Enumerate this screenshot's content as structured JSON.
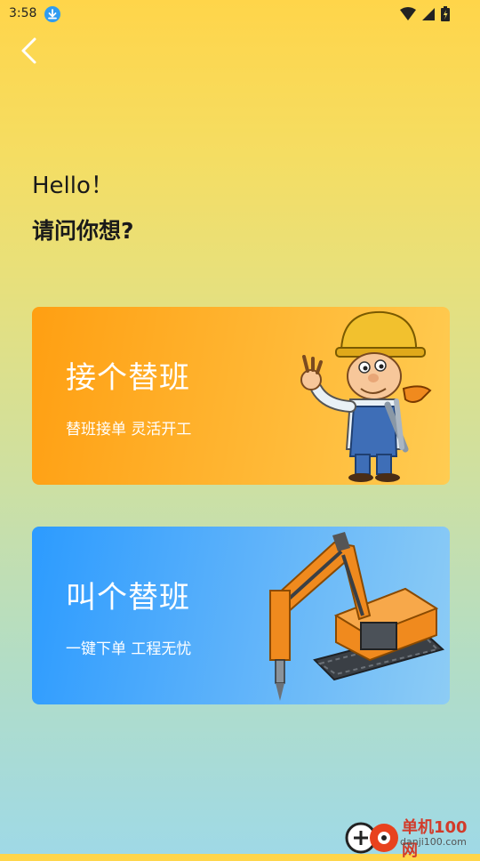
{
  "status_bar": {
    "time": "3:58"
  },
  "greeting": {
    "hello": "Hello！",
    "question": "请问你想?"
  },
  "cards": [
    {
      "title": "接个替班",
      "subtitle": "替班接单 灵活开工"
    },
    {
      "title": "叫个替班",
      "subtitle": "一键下单 工程无忧"
    }
  ],
  "watermark": {
    "brand": "单机100网",
    "url": "danji100.com"
  },
  "colors": {
    "accent_orange": "#FF9F12",
    "accent_blue": "#2C9BFF"
  }
}
